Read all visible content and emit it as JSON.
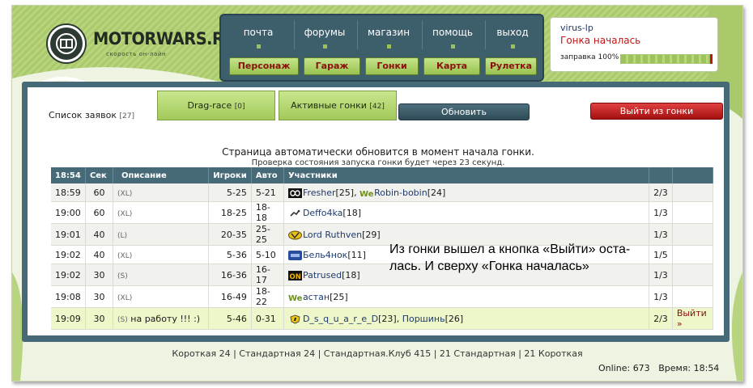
{
  "logo": {
    "title": "MOTORWARS.RU",
    "subtitle": "скорость он-лайн"
  },
  "topnav": {
    "links": [
      "почта",
      "форумы",
      "магазин",
      "помощь",
      "выход"
    ],
    "buttons": [
      "Персонаж",
      "Гараж",
      "Гонки",
      "Карта",
      "Рулетка"
    ]
  },
  "user": {
    "name": "virus-lp",
    "status": "Гонка началась",
    "fuel_label": "заправка 100%",
    "fuel_percent": 100
  },
  "panel": {
    "list_label": "Список заявок",
    "list_count": "[27]",
    "tab_drag": "Drag-race",
    "tab_drag_count": "[0]",
    "tab_active": "Активные гонки",
    "tab_active_count": "[42]",
    "refresh_label": "Обновить",
    "exit_race_label": "Выйти из гонки",
    "notice_main": "Страница автоматически обновится в момент начала гонки.",
    "notice_sub": "Проверка состояния запуска гонки будет через 23 секунд."
  },
  "table": {
    "headers": [
      "18:54",
      "Сек",
      "Описание",
      "Игроки",
      "Авто",
      "Участники",
      "",
      ""
    ],
    "rows": [
      {
        "time": "18:59",
        "sec": "60",
        "desc": "(XL)",
        "players": "5-25",
        "auto": "5-21",
        "participants": [
          {
            "icon": "infinity-clan-icon",
            "name": "Fresher",
            "level": "[25]"
          },
          {
            "icon": "we-clan-icon",
            "name": "Robin-bobin",
            "level": "[24]"
          }
        ],
        "slots": "2/3",
        "action": ""
      },
      {
        "time": "19:00",
        "sec": "60",
        "desc": "(XL)",
        "players": "18-25",
        "auto": "18-18",
        "participants": [
          {
            "icon": "scorpion-clan-icon",
            "name": "Deffo4ka",
            "level": "[18]"
          }
        ],
        "slots": "1/3",
        "action": ""
      },
      {
        "time": "19:01",
        "sec": "40",
        "desc": "(L)",
        "players": "20-35",
        "auto": "25-25",
        "participants": [
          {
            "icon": "yellow-badge-clan-icon",
            "name": "Lord Ruthven",
            "level": "[29]"
          }
        ],
        "slots": "1/3",
        "action": ""
      },
      {
        "time": "19:02",
        "sec": "40",
        "desc": "(XL)",
        "players": "5-36",
        "auto": "5-10",
        "participants": [
          {
            "icon": "blue-car-clan-icon",
            "name": "Бель4нок",
            "level": "[11]"
          }
        ],
        "slots": "1/5",
        "action": ""
      },
      {
        "time": "19:02",
        "sec": "30",
        "desc": "(S)",
        "players": "16-36",
        "auto": "16-17",
        "participants": [
          {
            "icon": "on-clan-icon",
            "name": "Patrused",
            "level": "[18]"
          }
        ],
        "slots": "1/3",
        "action": ""
      },
      {
        "time": "19:08",
        "sec": "30",
        "desc": "(XL)",
        "players": "16-49",
        "auto": "18-22",
        "participants": [
          {
            "icon": "we-clan-icon",
            "name": "астан",
            "level": "[25]"
          }
        ],
        "slots": "1/3",
        "action": ""
      },
      {
        "time": "19:09",
        "sec": "30",
        "desc": "(S)",
        "desc_note": "на работу !!! :)",
        "players": "5-46",
        "auto": "0-31",
        "participants": [
          {
            "icon": "horse-clan-icon",
            "name": "D_s_q_u_a_r_e_D",
            "level": "[23]"
          },
          {
            "icon": "",
            "name": "Поршинь",
            "level": "[26]"
          }
        ],
        "slots": "2/3",
        "action": "Выйти »"
      }
    ]
  },
  "overlay_note": "Из гонки вышел а кнопка «Выйти» оста-лась. И сверху «Гонка началась»",
  "overlay_line1": "Из гонки вышел а кнопка «Выйти» оста-",
  "overlay_line2": "лась. И сверху «Гонка началась»",
  "footer": {
    "links": "Короткая 24 | Стандартная 24 | Стандартная.Клуб 415 | 21 Стандартная | 21 Короткая",
    "online_label": "Online:",
    "online_value": "673",
    "time_label": "Время:",
    "time_value": "18:54"
  },
  "colors": {
    "accent_green": "#9fc054",
    "panel_blue": "#476a78",
    "danger_red": "#c21414"
  }
}
